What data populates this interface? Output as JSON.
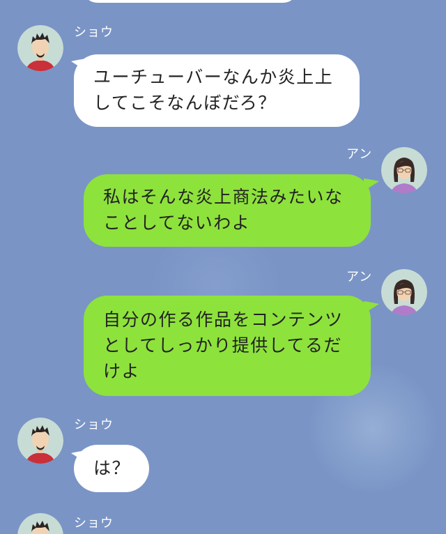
{
  "chat": {
    "messages": [
      {
        "sender": "ショウ",
        "side": "left",
        "text": "ユーチューバーなんか炎上上\nしてこそなんぼだろ？"
      },
      {
        "sender": "アン",
        "side": "right",
        "text": "私はそんな炎上商法みたいな\nことしてないわよ"
      },
      {
        "sender": "アン",
        "side": "right",
        "text": "自分の作る作品をコンテンツ\nとしてしっかり提供してるだ\nけよ"
      },
      {
        "sender": "ショウ",
        "side": "left",
        "text": "は？"
      },
      {
        "sender": "ショウ",
        "side": "left",
        "text": ""
      }
    ]
  },
  "colors": {
    "background": "#7a94c6",
    "incoming_bubble": "#ffffff",
    "outgoing_bubble": "#8ee23c",
    "sender_name": "#ffffff"
  },
  "icons": {
    "sho_avatar": "man-avatar-icon",
    "an_avatar": "woman-avatar-icon"
  }
}
